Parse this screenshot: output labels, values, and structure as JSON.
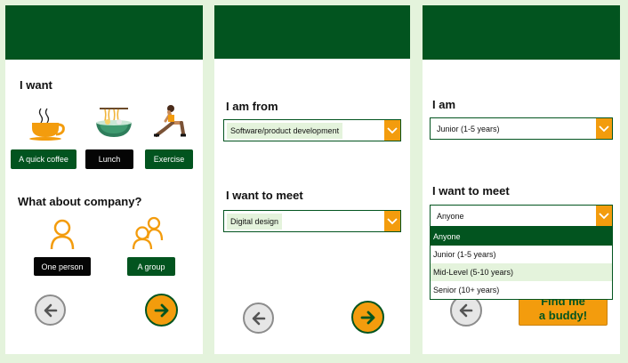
{
  "screen1": {
    "heading_want": "I want",
    "activities": [
      {
        "label": "A quick coffee",
        "icon": "coffee-icon"
      },
      {
        "label": "Lunch",
        "icon": "noodle-bowl-icon"
      },
      {
        "label": "Exercise",
        "icon": "exercise-icon"
      }
    ],
    "heading_company": "What about company?",
    "company": [
      {
        "label": "One person",
        "icon": "person-icon"
      },
      {
        "label": "A group",
        "icon": "group-icon"
      }
    ],
    "nav": {
      "back_icon": "arrow-left-icon",
      "next_icon": "arrow-right-icon"
    }
  },
  "screen2": {
    "heading_from": "I am from",
    "from_value": "Software/product development",
    "heading_meet": "I want to meet",
    "meet_value": "Digital design",
    "nav": {
      "back_icon": "arrow-left-icon",
      "next_icon": "arrow-right-icon"
    }
  },
  "screen3": {
    "heading_am": "I am",
    "am_value": "Junior (1-5 years)",
    "heading_meet": "I want to meet",
    "meet_value": "Anyone",
    "options": [
      "Anyone",
      "Junior (1-5 years)",
      "Mid-Level (5-10 years)",
      "Senior (10+ years)"
    ],
    "selected_option": "Anyone",
    "hovered_option": "Mid-Level (5-10 years)",
    "find_label_line1": "Find me",
    "find_label_line2": "a buddy!"
  },
  "colors": {
    "brand_green": "#02541f",
    "accent_orange": "#f39c0d",
    "background_mint": "#e4f3dc"
  }
}
